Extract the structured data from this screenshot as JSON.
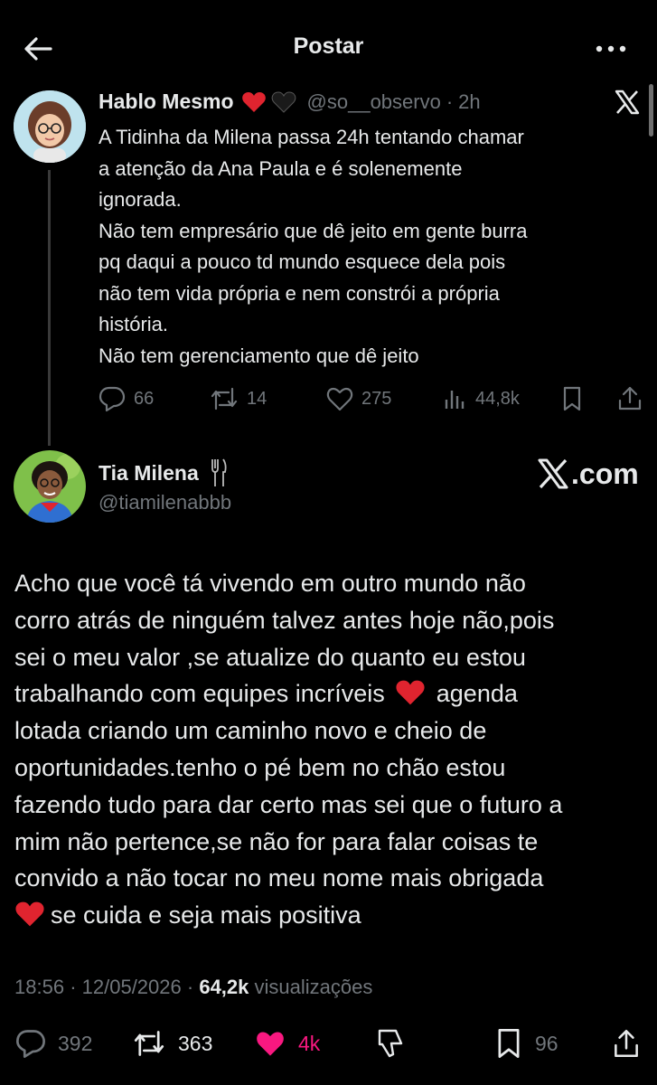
{
  "header": {
    "title": "Postar"
  },
  "quoted": {
    "name": "Hablo Mesmo",
    "handle": "@so__observo",
    "separator": "·",
    "time": "2h",
    "lines": [
      "A Tidinha da Milena passa 24h tentando chamar",
      "a atenção da Ana Paula e é solenemente",
      "ignorada.",
      "Não tem empresário que dê jeito em gente burra",
      "pq daqui a pouco td mundo esquece dela pois",
      "não tem vida própria e nem constrói a própria",
      "história.",
      "Não tem gerenciamento que dê jeito"
    ],
    "stats": {
      "replies": "66",
      "reposts": "14",
      "likes": "275",
      "views": "44,8k"
    }
  },
  "main": {
    "name": "Tia Milena",
    "handle": "@tiamilenabbb",
    "watermark": ".com",
    "lines": [
      "Acho que você tá vivendo em outro mundo não",
      "corro atrás de ninguém talvez antes hoje não,pois",
      "sei o meu valor ,se atualize do quanto eu estou",
      "trabalhando com equipes incríveis",
      "agenda",
      "lotada criando um caminho novo e cheio de",
      "oportunidades.tenho o pé bem no chão estou",
      "fazendo tudo para dar certo mas sei que o futuro a",
      "mim não pertence,se não for para falar coisas te",
      "convido a não tocar no meu nome mais obrigada",
      "se cuida e seja mais positiva"
    ],
    "time": "18:56",
    "dot": "·",
    "date": "12/05/2026",
    "views_count": "64,2k",
    "views_label": "visualizações",
    "stats": {
      "replies": "392",
      "reposts": "363",
      "likes": "4k",
      "bookmarks": "96"
    }
  },
  "colors": {
    "background": "#000000",
    "text": "#e7e9ea",
    "muted": "#71767b",
    "like_active": "#f91880",
    "heart_red": "#e0242f"
  }
}
